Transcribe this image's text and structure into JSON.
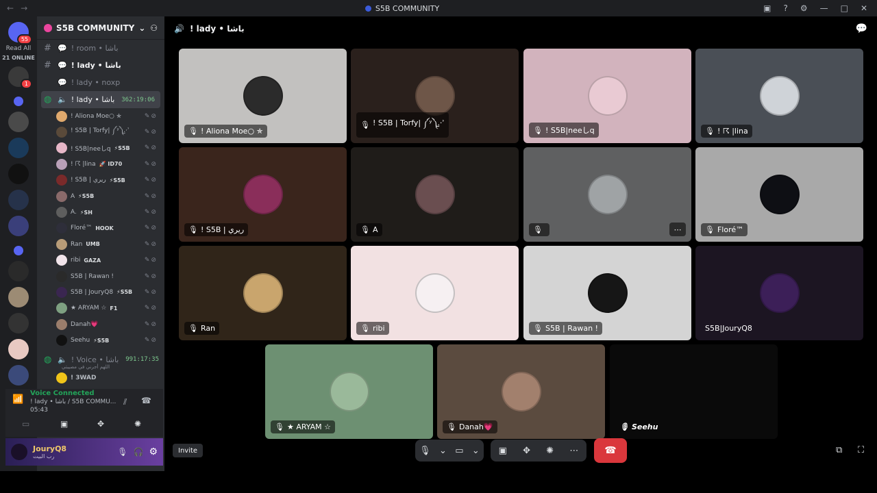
{
  "titlebar": {
    "title": "S5B COMMUNITY",
    "back": "←",
    "forward": "→"
  },
  "rail": {
    "mention_badge": "55",
    "read_all": "Read All",
    "online": "21 ONLINE",
    "unread_badge": "1"
  },
  "sidebar": {
    "server_name": "S5B COMMUNITY",
    "channels": [
      {
        "name": "! room • باشا"
      },
      {
        "name": "! lady • باشا"
      },
      {
        "name": "! lady • noxp"
      }
    ],
    "voice_channel": {
      "name": "! lady • باشا",
      "timer": "362:19:06"
    },
    "members": [
      {
        "name": "! Aliona Moe○ ✯",
        "tag": "",
        "color": "#e0a96d"
      },
      {
        "name": "! S5B | Torfy| ༼ʸ༽.̫·ʾ",
        "tag": "",
        "color": "#5a4a3a"
      },
      {
        "name": "! S5B|neeしq",
        "tag": "⚡S5B",
        "color": "#e7b7c8"
      },
      {
        "name": "! ☈ |lina",
        "tag": "🚀 ID70",
        "color": "#b9a0b8"
      },
      {
        "name": "! S5B | ريري",
        "tag": "⚡S5B",
        "color": "#7a2a2a"
      },
      {
        "name": "A",
        "tag": "⚡S5B",
        "color": "#8a6a6a"
      },
      {
        "name": "A.",
        "tag": "⚡SH",
        "color": "#5e5e5e"
      },
      {
        "name": "Floré™",
        "tag": "HOOK",
        "color": "#2e2e3a"
      },
      {
        "name": "Ran",
        "tag": "UMB",
        "color": "#b89c78"
      },
      {
        "name": "ribi",
        "tag": "GAZA",
        "color": "#f1e4ea"
      },
      {
        "name": "S5B | Rawan !",
        "tag": "",
        "color": "#2a2a2a"
      },
      {
        "name": "S5B | JouryQ8",
        "tag": "⚡S5B",
        "color": "#3a2650"
      },
      {
        "name": "★ ARYAM ☆",
        "tag": "F1",
        "color": "#7ea081"
      },
      {
        "name": "Danah💗",
        "tag": "",
        "color": "#9a7d6b"
      },
      {
        "name": "Seehu",
        "tag": "⚡S5B",
        "color": "#111111"
      }
    ],
    "voice_channel2": {
      "name": "! Voice • باشا",
      "timer": "991:17:35",
      "sub": "اللهم أجرني في مصيبتي"
    },
    "partial_member": "! 3WAD",
    "voice_status": {
      "label": "Voice Connected",
      "channel": "! lady • باشا / S5B COMMU...",
      "time": "05:43"
    },
    "user": {
      "name": "JouryQ8",
      "status": "رب البيت"
    }
  },
  "topbar": {
    "channel": "! lady • باشا"
  },
  "tiles": [
    {
      "name": "! Aliona Moe○ ✯",
      "bg": "#c2c1bf",
      "av": "#2b2b2b"
    },
    {
      "name": "! S5B | Torfy| ༼ʸ༽.̫·ʾ",
      "bg": "#2a201c",
      "av": "#6e5648"
    },
    {
      "name": "! S5B|neeしq",
      "bg": "#d2b3bd",
      "av": "#e9cad3"
    },
    {
      "name": "! ☈ |lina",
      "bg": "#4a4f56",
      "av": "#cfd3d8"
    },
    {
      "name": "! S5B | ريري",
      "bg": "#3a251c",
      "av": "#8a2e5a"
    },
    {
      "name": "A",
      "bg": "#1f1c19",
      "av": "#6a4e50"
    },
    {
      "name": "",
      "bg": "#5f6061",
      "av": "#9fa3a5"
    },
    {
      "name": "Floré™",
      "bg": "#a9a9a9",
      "av": "#0e0f14"
    },
    {
      "name": "Ran",
      "bg": "#302519",
      "av": "#c9a56d"
    },
    {
      "name": "ribi",
      "bg": "#f2e1e2",
      "av": "#f6f0f2"
    },
    {
      "name": "S5B | Rawan !",
      "bg": "#d4d4d4",
      "av": "#161616"
    },
    {
      "name": "S5B|JouryQ8",
      "bg": "#1c1522",
      "av": "#3c1f58"
    },
    {
      "name": "★ ARYAM ☆",
      "bg": "#6d9072",
      "av": "#9ab99a"
    },
    {
      "name": "Danah💗",
      "bg": "#5b4b3f",
      "av": "#a2806d"
    },
    {
      "name": "Seehu",
      "bg": "#0a0a0a",
      "av": "#0a0a0a"
    }
  ],
  "bottombar": {
    "invite": "Invite"
  }
}
